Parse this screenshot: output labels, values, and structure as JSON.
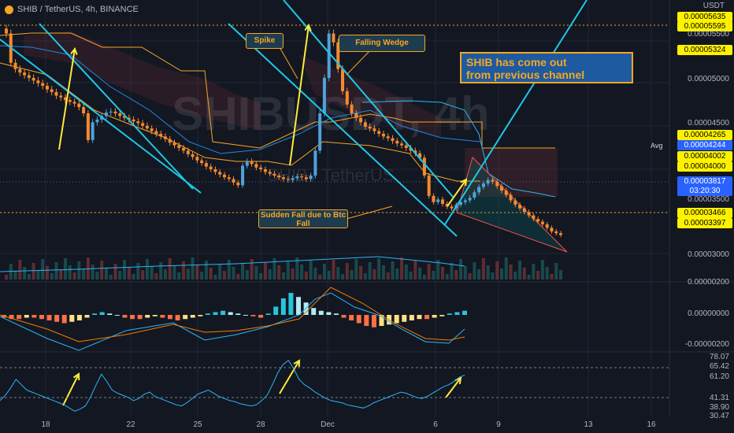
{
  "header": {
    "title": "SHIB / TetherUS, 4h, BINANCE"
  },
  "watermark": "SHIBUSDT, 4h",
  "watermark_sub": "SHIB / TetherUS",
  "axis": {
    "unit": "USDT",
    "avg_label": "Avg",
    "price_ticks": [
      "0.00005500",
      "0.00005000",
      "0.00004500",
      "0.00003500",
      "0.00003000",
      "0.00000200",
      "0.00000000",
      "-0.00000200",
      "78.07",
      "65.42",
      "61.20",
      "41.31",
      "38.90",
      "30.47"
    ],
    "price_tags": {
      "t1": "0.00005635",
      "t2": "0.00005595",
      "t3": "0.00005324",
      "t4": "0.00004265",
      "t5": "0.00004244",
      "t6": "0.00004002",
      "t7": "0.00004000",
      "t8": "0.00003817",
      "t9": "03:20:30",
      "t10": "0.00003466",
      "t11": "0.00003397"
    },
    "x_ticks": [
      "18",
      "22",
      "25",
      "28",
      "Dec",
      "6",
      "9",
      "13",
      "16"
    ]
  },
  "annotations": {
    "spike": "Spike",
    "falling_wedge": "Falling Wedge",
    "sudden_fall": "Sudden Fall due to Btc Fall",
    "big_note_line1": "SHIB has come out",
    "big_note_line2": "from previous channel"
  },
  "colors": {
    "up": "#26a69a",
    "down": "#ef5350",
    "up_candle": "#4fa3d9",
    "down_candle": "#f58a2e",
    "trendline": "#1ec8e6",
    "arrow": "#ffeb3b",
    "orange": "#f6a623"
  },
  "chart_data": {
    "type": "candlestick",
    "symbol": "SHIB / TetherUS",
    "interval": "4h",
    "exchange": "BINANCE",
    "ylim": [
      2.9e-05,
      5.65e-05
    ],
    "close": [
      5.45e-05,
      5.12e-05,
      5.05e-05,
      5.01e-05,
      4.98e-05,
      4.95e-05,
      4.92e-05,
      4.89e-05,
      4.86e-05,
      4.82e-05,
      4.79e-05,
      4.75e-05,
      4.73e-05,
      4.7e-05,
      4.68e-05,
      4.66e-05,
      4.62e-05,
      4.55e-05,
      4.25e-05,
      4.45e-05,
      4.48e-05,
      4.52e-05,
      4.56e-05,
      4.57e-05,
      4.55e-05,
      4.52e-05,
      4.5e-05,
      4.48e-05,
      4.46e-05,
      4.44e-05,
      4.41e-05,
      4.38e-05,
      4.35e-05,
      4.32e-05,
      4.29e-05,
      4.26e-05,
      4.22e-05,
      4.19e-05,
      4.16e-05,
      4.13e-05,
      4.09e-05,
      4.06e-05,
      4.02e-05,
      3.99e-05,
      3.95e-05,
      3.92e-05,
      3.89e-05,
      3.86e-05,
      3.83e-05,
      3.81e-05,
      3.77e-05,
      3.74e-05,
      3.96e-05,
      4.01e-05,
      3.98e-05,
      3.94e-05,
      3.92e-05,
      3.89e-05,
      3.87e-05,
      3.85e-05,
      3.83e-05,
      3.81e-05,
      3.8e-05,
      3.82e-05,
      3.84e-05,
      3.83e-05,
      3.81e-05,
      3.85e-05,
      4.13e-05,
      4.55e-05,
      4.95e-05,
      5.45e-05,
      5.35e-05,
      5.05e-05,
      4.8e-05,
      4.65e-05,
      4.55e-05,
      4.5e-05,
      4.45e-05,
      4.4e-05,
      4.38e-05,
      4.35e-05,
      4.32e-05,
      4.29e-05,
      4.27e-05,
      4.24e-05,
      4.21e-05,
      4.19e-05,
      4.16e-05,
      4.13e-05,
      4.1e-05,
      4.05e-05,
      3.85e-05,
      3.62e-05,
      3.55e-05,
      3.58e-05,
      3.53e-05,
      3.5e-05,
      3.48e-05,
      3.52e-05,
      3.55e-05,
      3.57e-05,
      3.6e-05,
      3.66e-05,
      3.72e-05,
      3.76e-05,
      3.8e-05,
      3.78e-05,
      3.73e-05,
      3.68e-05,
      3.63e-05,
      3.57e-05,
      3.52e-05,
      3.48e-05,
      3.44e-05,
      3.4e-05,
      3.36e-05,
      3.33e-05,
      3.3e-05,
      3.26e-05,
      3.22e-05,
      3.2e-05,
      3.18e-05
    ],
    "macd_histogram": [
      -2e-07,
      -3e-07,
      -3e-07,
      -2e-07,
      -2e-07,
      -3e-07,
      -4e-07,
      -5e-07,
      -6e-07,
      -5e-07,
      -4e-07,
      -2e-07,
      1e-07,
      2e-07,
      1e-07,
      0.0,
      -2e-07,
      -3e-07,
      -3e-07,
      -2e-07,
      -1e-07,
      -2e-07,
      -3e-07,
      -4e-07,
      -3e-07,
      -2e-07,
      -1e-07,
      1e-07,
      2e-07,
      3e-07,
      2e-07,
      1e-07,
      0.0,
      -1e-07,
      -2e-07,
      1e-07,
      6e-07,
      1.2e-06,
      1.6e-06,
      1.3e-06,
      9e-07,
      5e-07,
      3e-07,
      2e-07,
      1e-07,
      -2e-07,
      -4e-07,
      -6e-07,
      -8e-07,
      -9e-07,
      -8e-07,
      -7e-07,
      -6e-07,
      -5e-07,
      -4e-07,
      -3e-07,
      -3e-07,
      -2e-07,
      -1e-07,
      1e-07,
      2e-07,
      3e-07
    ],
    "rsi": [
      40,
      45,
      52,
      60,
      55,
      50,
      48,
      46,
      44,
      42,
      40,
      38,
      36,
      33,
      30,
      32,
      35,
      44,
      55,
      65,
      58,
      50,
      47,
      45,
      43,
      40,
      42,
      46,
      48,
      44,
      42,
      40,
      38,
      36,
      35,
      38,
      42,
      46,
      48,
      50,
      47,
      44,
      42,
      40,
      39,
      37,
      36,
      35,
      36,
      40,
      45,
      55,
      66,
      74,
      78,
      70,
      60,
      55,
      52,
      48,
      45,
      42,
      40,
      39,
      38,
      36,
      35,
      34,
      33,
      35,
      38,
      40,
      42,
      44,
      46,
      48,
      47,
      45,
      43,
      42,
      44,
      47,
      50,
      53,
      55,
      58,
      62,
      64
    ]
  }
}
